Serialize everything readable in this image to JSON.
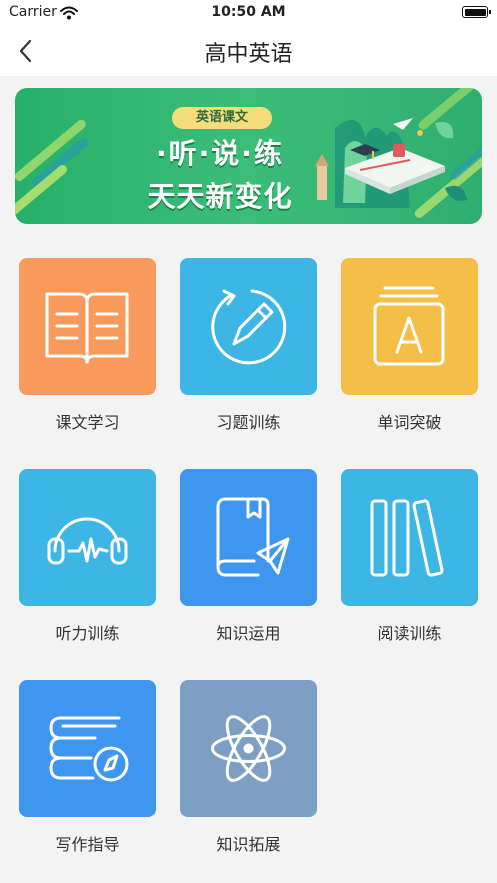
{
  "status": {
    "carrier": "Carrier",
    "time": "10:50 AM"
  },
  "nav": {
    "title": "高中英语",
    "back_icon": "chevron-left-icon"
  },
  "banner": {
    "tag": "英语课文",
    "line1": "·听·说·练",
    "line2": "天天新变化",
    "colors": {
      "bg": "#2fb06d",
      "tag": "#f6dd7b"
    }
  },
  "tiles": [
    {
      "label": "课文学习",
      "icon": "open-book-icon",
      "color": "#f89a5c"
    },
    {
      "label": "习题训练",
      "icon": "pencil-circle-icon",
      "color": "#3db6e6"
    },
    {
      "label": "单词突破",
      "icon": "letter-card-icon",
      "color": "#f5be46"
    },
    {
      "label": "听力训练",
      "icon": "headphones-icon",
      "color": "#3db6e6"
    },
    {
      "label": "知识运用",
      "icon": "book-paper-plane-icon",
      "color": "#3f96ee"
    },
    {
      "label": "阅读训练",
      "icon": "books-icon",
      "color": "#3db6e6"
    },
    {
      "label": "写作指导",
      "icon": "books-compass-icon",
      "color": "#3f96ee"
    },
    {
      "label": "知识拓展",
      "icon": "atom-icon",
      "color": "#7d9fc3"
    }
  ]
}
